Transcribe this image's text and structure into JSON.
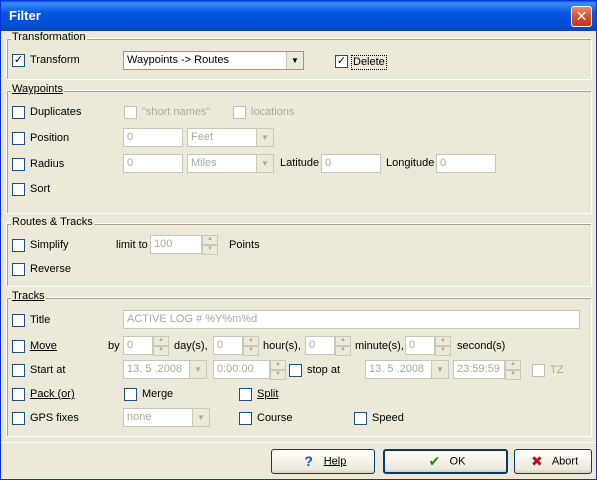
{
  "window": {
    "title": "Filter",
    "close_glyph": "✕"
  },
  "transformation": {
    "legend": "Transformation",
    "transform_label": "Transform",
    "transform_checked": true,
    "mode_value": "Waypoints -> Routes",
    "delete_label": "Delete",
    "delete_checked": true
  },
  "waypoints": {
    "legend": "Waypoints",
    "duplicates_label": "Duplicates",
    "short_names_label": "\"short names\"",
    "locations_label": "locations",
    "position_label": "Position",
    "position_value": "0",
    "position_unit": "Feet",
    "radius_label": "Radius",
    "radius_value": "0",
    "radius_unit": "Miles",
    "latitude_label": "Latitude",
    "latitude_value": "0",
    "longitude_label": "Longitude",
    "longitude_value": "0",
    "sort_label": "Sort"
  },
  "routes_tracks": {
    "legend": "Routes & Tracks",
    "simplify_label": "Simplify",
    "limit_to_label": "limit to",
    "limit_value": "100",
    "points_label": "Points",
    "reverse_label": "Reverse"
  },
  "tracks": {
    "legend": "Tracks",
    "title_label": "Title",
    "title_value": "ACTIVE LOG # %Y%m%d",
    "move_label": "Move",
    "by_label": "by",
    "days_value": "0",
    "days_label": "day(s),",
    "hours_value": "0",
    "hours_label": "hour(s),",
    "minutes_value": "0",
    "minutes_label": "minute(s),",
    "seconds_value": "0",
    "seconds_label": "second(s)",
    "start_at_label": "Start at",
    "start_date": "13. 5 .2008",
    "start_time": "0:00:00",
    "stop_at_label": "stop at",
    "stop_date": "13. 5 .2008",
    "stop_time": "23:59:59",
    "tz_label": "TZ",
    "pack_label": "Pack (or)",
    "merge_label": "Merge",
    "split_label": "Split",
    "gps_fixes_label": "GPS fixes",
    "gps_fixes_value": "none",
    "course_label": "Course",
    "speed_label": "Speed"
  },
  "buttons": {
    "help": "Help",
    "ok": "OK",
    "abort": "Abort"
  },
  "colors": {
    "titlebar": "#0355e0",
    "ok_icon": "#1a8a1a",
    "abort_icon": "#b8141a",
    "help_icon": "#1f4fb8"
  }
}
